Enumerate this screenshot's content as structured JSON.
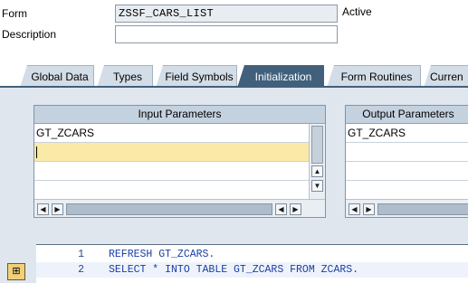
{
  "form": {
    "label": "Form",
    "value": "ZSSF_CARS_LIST",
    "status": "Active"
  },
  "description": {
    "label": "Description",
    "value": ""
  },
  "tabs": [
    {
      "label": "Global Data",
      "active": false
    },
    {
      "label": "Types",
      "active": false
    },
    {
      "label": "Field Symbols",
      "active": false
    },
    {
      "label": "Initialization",
      "active": true
    },
    {
      "label": "Form Routines",
      "active": false
    },
    {
      "label": "Curren",
      "active": false
    }
  ],
  "input_parameters": {
    "title": "Input Parameters",
    "rows": [
      "GT_ZCARS",
      "",
      "",
      "",
      ""
    ]
  },
  "output_parameters": {
    "title": "Output Parameters",
    "rows": [
      "GT_ZCARS",
      "",
      "",
      "",
      ""
    ]
  },
  "editor": {
    "lines": [
      {
        "number": "1",
        "code": "REFRESH GT_ZCARS."
      },
      {
        "number": "2",
        "code": "SELECT * INTO TABLE GT_ZCARS FROM ZCARS."
      }
    ]
  },
  "icons": {
    "side_tool": "pattern-icon",
    "scroll_up": "arrow-up-icon",
    "scroll_down": "arrow-down-icon",
    "scroll_left": "arrow-left-icon",
    "scroll_right": "arrow-right-icon"
  },
  "colors": {
    "active_tab": "#41607c",
    "panel_bg": "#dfe6ee",
    "editing_row": "#fbe9a8",
    "code_keyword": "#1a3ea5"
  }
}
